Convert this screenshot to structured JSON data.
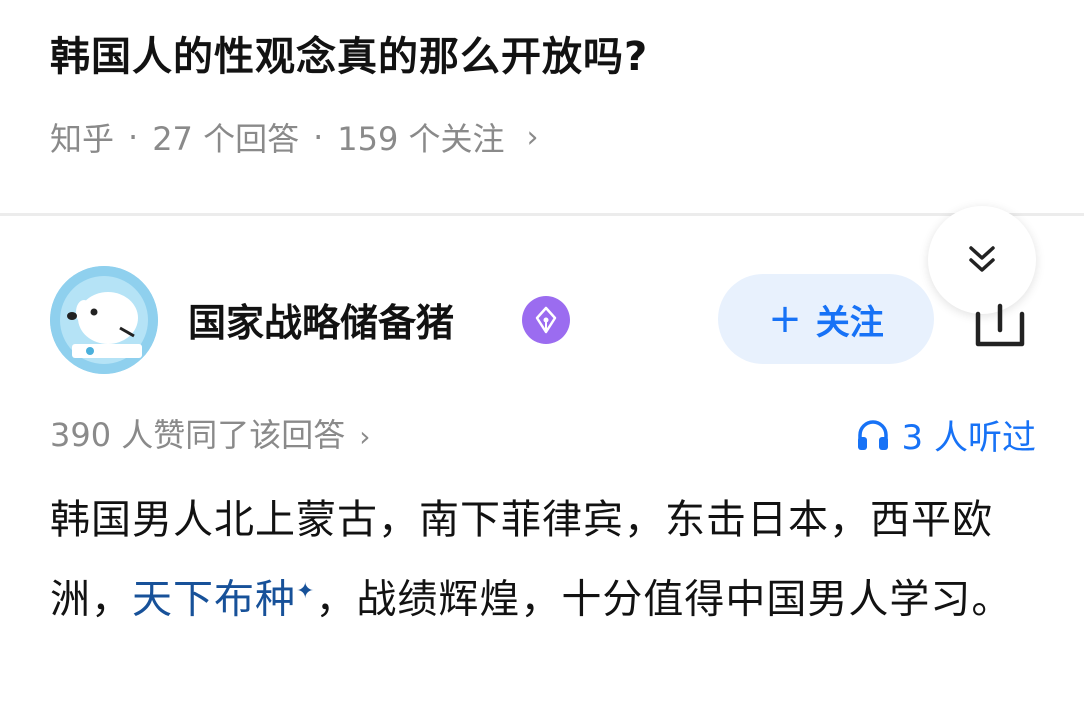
{
  "question": {
    "title": "韩国人的性观念真的那么开放吗?",
    "source": "知乎",
    "answers": "27 个回答",
    "followers": "159 个关注",
    "chevron": "›"
  },
  "answer": {
    "author_name": "国家战略储备猪",
    "follow_plus": "+",
    "follow_label": "关注",
    "votes": "390 人赞同了该回答",
    "votes_chevron": "›",
    "listened": "3 人听过",
    "content_part1": "韩国男人北上蒙古，南下菲律宾，东击日本，西平欧洲，",
    "content_link": "天下布种",
    "content_star": "✦",
    "content_part2": "，战绩辉煌，十分值得中国男人学习。"
  },
  "icons": {
    "collapse": "double-chevron-down-icon",
    "share": "share-icon",
    "badge": "pen-badge-icon",
    "headphones": "headphones-icon"
  },
  "colors": {
    "accent": "#1772f6",
    "link": "#175199",
    "follow_bg": "#e8f1fd",
    "badge": "#9b6cf0",
    "meta": "#8a8a8a"
  }
}
